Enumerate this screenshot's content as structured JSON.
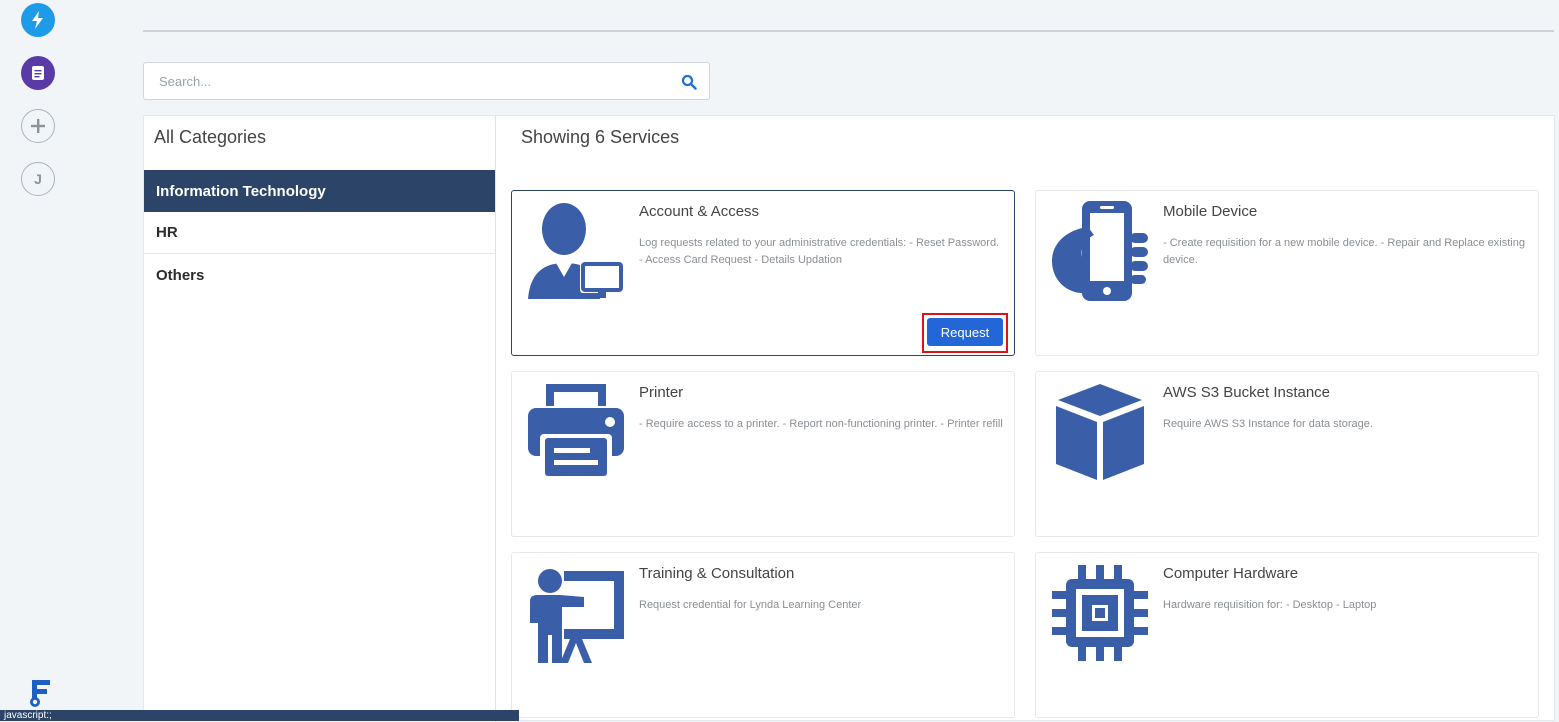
{
  "search": {
    "placeholder": "Search..."
  },
  "categories": {
    "title": "All Categories",
    "items": [
      {
        "label": "Information Technology",
        "active": true
      },
      {
        "label": "HR",
        "active": false
      },
      {
        "label": "Others",
        "active": false
      }
    ]
  },
  "services": {
    "title": "Showing 6 Services",
    "request_label": "Request",
    "cards": [
      {
        "title": "Account & Access",
        "description": "Log requests related to your administrative credentials:  - Reset Password. - Access Card Request - Details Updation",
        "icon": "user-computer-icon"
      },
      {
        "title": "Mobile Device",
        "description": "- Create requisition for a new mobile device. - Repair and Replace existing device.",
        "icon": "mobile-hand-icon"
      },
      {
        "title": "Printer",
        "description": "- Require access to a printer.  - Report non-functioning printer. - Printer refill",
        "icon": "printer-icon"
      },
      {
        "title": "AWS S3 Bucket Instance",
        "description": "Require AWS S3 Instance for data storage.",
        "icon": "cube-icon"
      },
      {
        "title": "Training & Consultation",
        "description": "Request credential for Lynda Learning Center",
        "icon": "presentation-icon"
      },
      {
        "title": "Computer Hardware",
        "description": "Hardware requisition for:  - Desktop - Laptop",
        "icon": "chip-icon"
      }
    ]
  },
  "rail": {
    "user_initial": "J"
  },
  "statusbar": {
    "text": "javascript:;"
  },
  "colors": {
    "accent": "#2c4468",
    "icon_blue": "#3b5ea8",
    "button": "#2266d8",
    "highlight": "#d9141b"
  }
}
